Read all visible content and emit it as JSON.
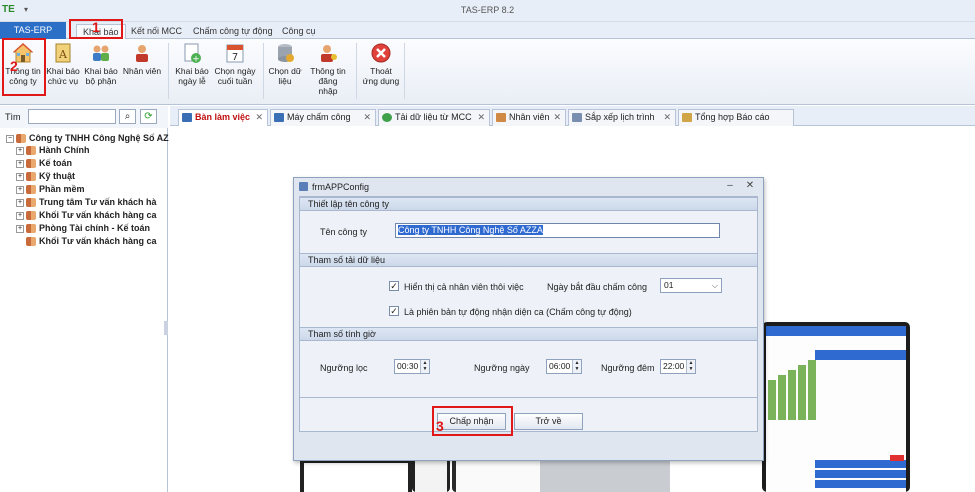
{
  "titlebar": {
    "title": "TAS-ERP 8.2",
    "quick_access": "TE",
    "qa_extra": "▾"
  },
  "ribbon_tabs": [
    "TAS-ERP v8.2",
    "Khai báo",
    "Kết nối MCC",
    "Chấm công tự động",
    "Công cụ"
  ],
  "ribbon_buttons": {
    "thong_tin": [
      "Thông tin",
      "công ty"
    ],
    "khai_bao_chuc_vu": [
      "Khai báo",
      "chức vụ"
    ],
    "khai_bao_bo_phan": [
      "Khai báo",
      "bộ phận"
    ],
    "nhan_vien": [
      "Nhân viên",
      ""
    ],
    "khai_bao_ngay_le": [
      "Khai báo",
      "ngày lễ"
    ],
    "chon_ngay_cuoi_tuan": [
      "Chọn ngày",
      "cuối tuần"
    ],
    "chon_du_lieu": [
      "Chọn dữ",
      "liệu"
    ],
    "thong_tin_dang_nhap": [
      "Thông tin",
      "đăng nhập"
    ],
    "thoat": [
      "Thoát",
      "ứng dụng"
    ]
  },
  "calendar_day": "7",
  "annotations": [
    "1",
    "2",
    "3"
  ],
  "search": {
    "label": "Tìm",
    "value": ""
  },
  "tree": [
    "Công ty TNHH Công Nghệ Số AZ",
    "Hành Chính",
    "Kế toán",
    "Kỹ thuật",
    "Phần mềm",
    "Trung tâm Tư vấn khách hà",
    "Khối Tư vấn khách hàng ca",
    "Phòng Tài chính - Kế toán",
    "Khối Tư vấn khách hàng ca"
  ],
  "doc_tabs": [
    "Bàn làm việc",
    "Máy chấm công",
    "Tải dữ liệu từ MCC",
    "Nhân viên",
    "Sắp xếp lịch trình",
    "Tổng hợp  Báo cáo"
  ],
  "dialog": {
    "title": "frmAPPConfig",
    "group1": "Thiết lập tên công ty",
    "company_label": "Tên công ty",
    "company_value": "Công ty TNHH Công Nghệ Số AZZA",
    "group2": "Tham số tải dữ liệu",
    "cb1": "Hiển thị cả nhân viên thôi việc",
    "cb2": "Là phiên bản tự động nhận diện ca (Chấm công tự động)",
    "start_day_label": "Ngày bắt đầu chấm công",
    "start_day_value": "01",
    "group3": "Tham số tính giờ",
    "filter_label": "Ngưỡng lọc",
    "filter_value": "00:30",
    "day_label": "Ngưỡng ngày",
    "day_value": "06:00",
    "night_label": "Ngưỡng đêm",
    "night_value": "22:00",
    "accept_button": "Chấp nhận",
    "back_button": "Trở về"
  },
  "colors": {
    "highlight": "#e01818",
    "app_tab": "#2c6fc6"
  }
}
